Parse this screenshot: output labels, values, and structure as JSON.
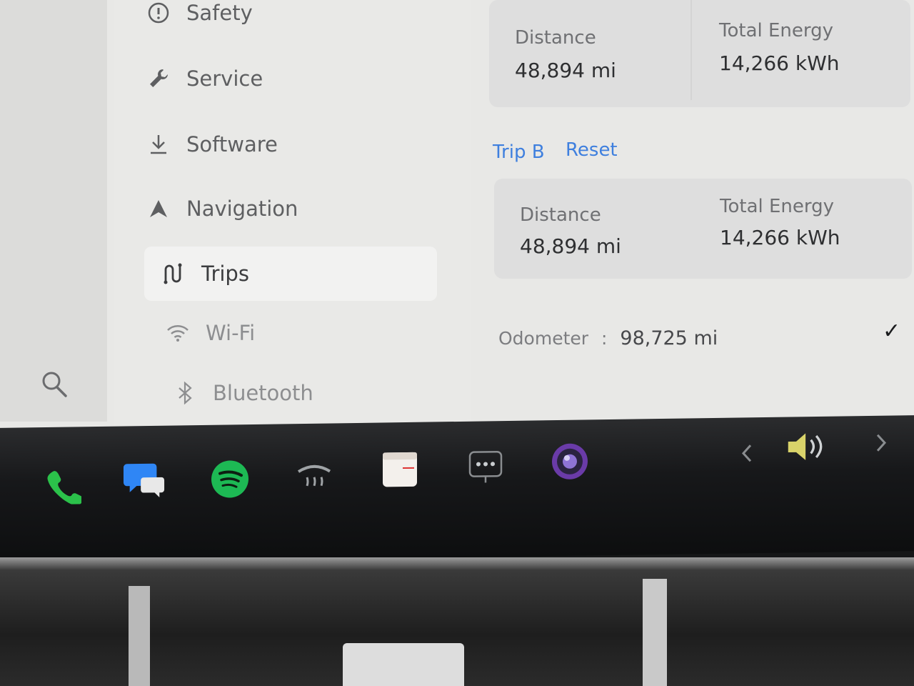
{
  "sidebar": {
    "items": [
      {
        "label": "Safety",
        "icon": "alert-circle-icon"
      },
      {
        "label": "Service",
        "icon": "wrench-icon"
      },
      {
        "label": "Software",
        "icon": "download-icon"
      },
      {
        "label": "Navigation",
        "icon": "navigation-arrow-icon"
      },
      {
        "label": "Trips",
        "icon": "trips-route-icon",
        "active": true
      },
      {
        "label": "Wi-Fi",
        "icon": "wifi-icon"
      },
      {
        "label": "Bluetooth",
        "icon": "bluetooth-icon"
      }
    ]
  },
  "trip_a": {
    "distance_label": "Distance",
    "distance_value": "48,894 mi",
    "energy_label": "Total Energy",
    "energy_value": "14,266 kWh"
  },
  "trip_b": {
    "title": "Trip B",
    "reset_label": "Reset",
    "distance_label": "Distance",
    "distance_value": "48,894 mi",
    "energy_label": "Total Energy",
    "energy_value": "14,266 kWh"
  },
  "odometer": {
    "label": "Odometer",
    "separator": ":",
    "value": "98,725 mi"
  },
  "dock": {
    "icons": [
      "phone-icon",
      "messages-icon",
      "spotify-icon",
      "defrost-icon",
      "calendar-icon",
      "more-apps-icon",
      "camera-icon",
      "volume-icon"
    ]
  },
  "colors": {
    "accent": "#3e7fde",
    "phone": "#2bc14a",
    "messages": "#2f86f5",
    "spotify": "#1db954"
  }
}
